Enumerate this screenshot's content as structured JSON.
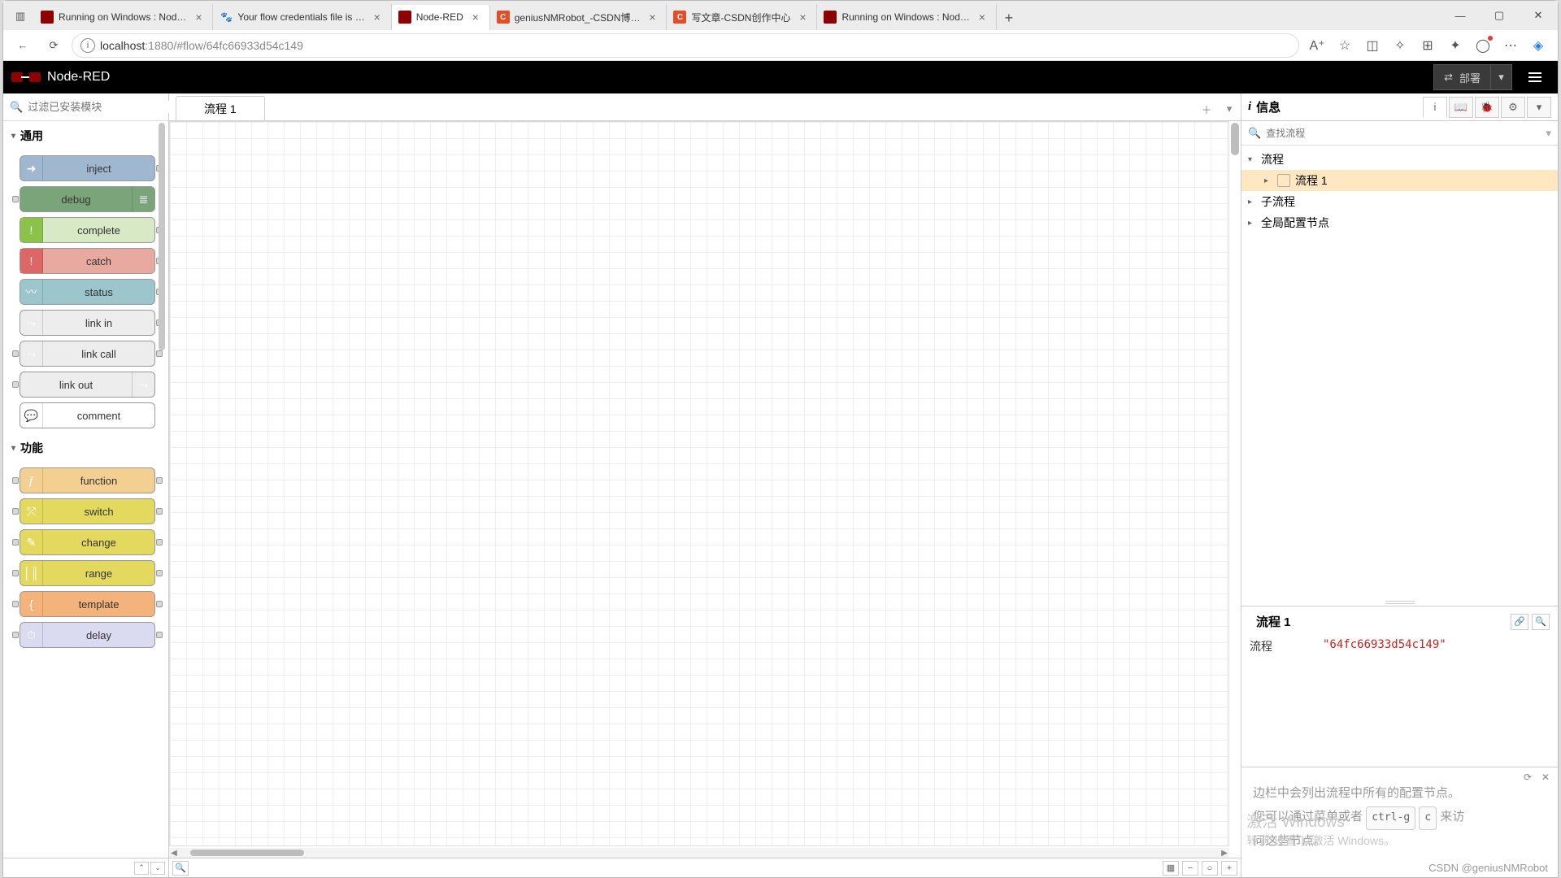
{
  "browser": {
    "tabs": [
      {
        "title": "Running on Windows : Nod…",
        "favicon": "red"
      },
      {
        "title": "Your flow credentials file is …",
        "favicon": "paw"
      },
      {
        "title": "Node-RED",
        "favicon": "red",
        "active": true
      },
      {
        "title": "geniusNMRobot_-CSDN博…",
        "favicon": "c"
      },
      {
        "title": "写文章-CSDN创作中心",
        "favicon": "c"
      },
      {
        "title": "Running on Windows : Nod…",
        "favicon": "red"
      }
    ],
    "url_host": "localhost",
    "url_port": ":1880",
    "url_path": "/#flow/64fc66933d54c149"
  },
  "nodered": {
    "title": "Node-RED",
    "deploy_label": "部署",
    "palette_search_placeholder": "过滤已安装模块",
    "categories": [
      {
        "name": "通用",
        "nodes": [
          {
            "label": "inject",
            "bg": "#9fb7cf",
            "icon": "➜",
            "port_l": false,
            "port_r": true
          },
          {
            "label": "debug",
            "bg": "#7aa57a",
            "icon": "≣",
            "port_l": true,
            "port_r": false,
            "icon_right": true
          },
          {
            "label": "complete",
            "bg": "#d8e9c6",
            "icon": "!",
            "port_l": false,
            "port_r": true,
            "iconbg": "#8bc34a"
          },
          {
            "label": "catch",
            "bg": "#e8a9a0",
            "icon": "!",
            "port_l": false,
            "port_r": true,
            "iconbg": "#d66"
          },
          {
            "label": "status",
            "bg": "#9cc6cc",
            "icon": "〰",
            "port_l": false,
            "port_r": true
          },
          {
            "label": "link in",
            "bg": "#ededed",
            "icon": "⤳",
            "port_l": false,
            "port_r": true
          },
          {
            "label": "link call",
            "bg": "#ededed",
            "icon": "⤳",
            "port_l": true,
            "port_r": true
          },
          {
            "label": "link out",
            "bg": "#ededed",
            "icon": "⤳",
            "port_l": true,
            "port_r": false,
            "icon_right": true
          },
          {
            "label": "comment",
            "bg": "#ffffff",
            "icon": "💬",
            "port_l": false,
            "port_r": false
          }
        ]
      },
      {
        "name": "功能",
        "nodes": [
          {
            "label": "function",
            "bg": "#f4cf92",
            "icon": "ƒ",
            "port_l": true,
            "port_r": true
          },
          {
            "label": "switch",
            "bg": "#e3d95f",
            "icon": "⤲",
            "port_l": true,
            "port_r": true
          },
          {
            "label": "change",
            "bg": "#e3d95f",
            "icon": "✎",
            "port_l": true,
            "port_r": true
          },
          {
            "label": "range",
            "bg": "#e3d95f",
            "icon": "│║",
            "port_l": true,
            "port_r": true
          },
          {
            "label": "template",
            "bg": "#f4b37a",
            "icon": "{",
            "port_l": true,
            "port_r": true
          },
          {
            "label": "delay",
            "bg": "#dadaf0",
            "icon": "⏱",
            "port_l": true,
            "port_r": true
          }
        ]
      }
    ],
    "workspace": {
      "tab": "流程 1"
    },
    "sidebar": {
      "title": "信息",
      "search_placeholder": "查找流程",
      "tree": {
        "flows": "流程",
        "flow1": "流程 1",
        "subflows": "子流程",
        "global": "全局配置节点"
      },
      "info": {
        "heading": "流程 1",
        "flow_label": "流程",
        "flow_id": "\"64fc66933d54c149\""
      },
      "tips": {
        "line1_a": "边栏中会列出流程中所有的配置节点。",
        "line2_a": "您可以通过菜单或者",
        "kbd1": "ctrl-g",
        "kbd2": "c",
        "line2_b": "来访",
        "line3": "问这些节点。"
      }
    }
  },
  "os": {
    "activate_title": "激活 Windows",
    "activate_sub": "转到\"设置\"以激活 Windows。",
    "watermark": "CSDN @geniusNMRobot"
  }
}
